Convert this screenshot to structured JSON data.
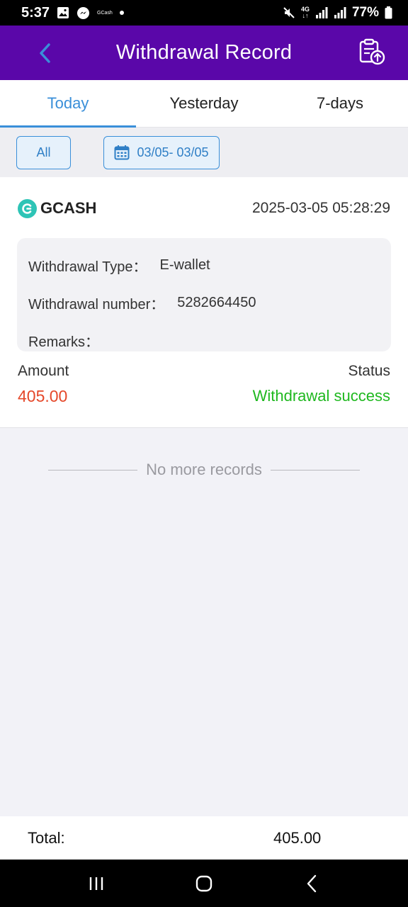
{
  "status_bar": {
    "time": "5:37",
    "gcash_label": "GCash",
    "network": "4G",
    "battery": "77%"
  },
  "header": {
    "title": "Withdrawal Record"
  },
  "tabs": [
    {
      "label": "Today",
      "active": true
    },
    {
      "label": "Yesterday",
      "active": false
    },
    {
      "label": "7-days",
      "active": false
    }
  ],
  "filters": {
    "type": "All",
    "date_range": "03/05- 03/05"
  },
  "record": {
    "method": "GCASH",
    "datetime": "2025-03-05 05:28:29",
    "type_label": "Withdrawal Type：",
    "type_value": "E-wallet",
    "number_label": "Withdrawal number：",
    "number_value": "5282664450",
    "remarks_label": "Remarks：",
    "remarks_value": "",
    "amount_label": "Amount",
    "amount_value": "405.00",
    "status_label": "Status",
    "status_value": "Withdrawal success"
  },
  "list_end": "No more records",
  "footer": {
    "total_label": "Total:",
    "total_value": "405.00"
  },
  "colors": {
    "header_bg": "#5a07a9",
    "accent": "#3a8fd9",
    "amount": "#e5482a",
    "success": "#1fb81f"
  }
}
